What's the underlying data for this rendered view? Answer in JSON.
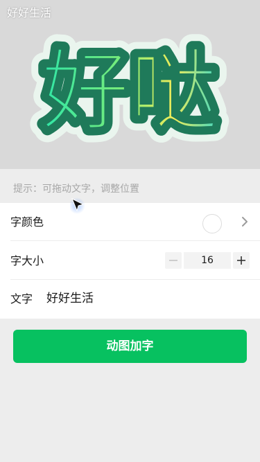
{
  "preview": {
    "draggable_text": "好好生活",
    "sticker_text": "好哒"
  },
  "hint": "提示：可拖动文字，调整位置",
  "settings": {
    "font_color_label": "字颜色",
    "font_color_value": "#ffffff",
    "font_size_label": "字大小",
    "font_size_value": "16",
    "text_label": "文字",
    "text_value": "好好生活"
  },
  "action_button": "动图加字",
  "colors": {
    "accent": "#07c160",
    "sticker_outline": "#1f7a5a",
    "sticker_fill_start": "#2ee6a8",
    "sticker_fill_end": "#f2ec5a"
  },
  "icons": {
    "stepper_minus": "minus-icon",
    "stepper_plus": "plus-icon",
    "chevron": "chevron-right-icon",
    "cursor": "mouse-pointer-icon"
  }
}
